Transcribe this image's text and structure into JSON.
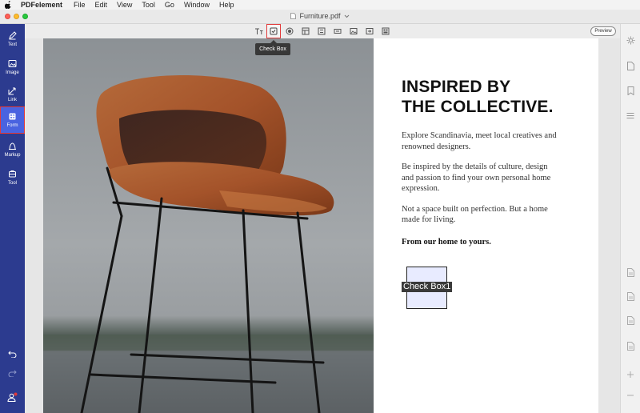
{
  "menubar": {
    "app_name": "PDFelement",
    "items": [
      "File",
      "Edit",
      "View",
      "Tool",
      "Go",
      "Window",
      "Help"
    ]
  },
  "window": {
    "title": "Furniture.pdf"
  },
  "sidebar": {
    "tools": [
      {
        "label": "Text",
        "icon": "text-edit-icon"
      },
      {
        "label": "Image",
        "icon": "image-icon"
      },
      {
        "label": "Link",
        "icon": "link-icon"
      },
      {
        "label": "Form",
        "icon": "form-icon",
        "active": true
      },
      {
        "label": "Markup",
        "icon": "markup-icon"
      },
      {
        "label": "Tool",
        "icon": "tool-icon"
      }
    ]
  },
  "toolbar": {
    "selected_tool": "check-box",
    "tooltip": "Check Box",
    "preview_label": "Preview"
  },
  "document": {
    "headline_line1": "INSPIRED BY",
    "headline_line2": "THE COLLECTIVE.",
    "para1": "Explore Scandinavia, meet local creatives and renowned designers.",
    "para2": "Be inspired by the details of culture, design and passion to find your own personal home expression.",
    "para3": "Not a space built on perfection. But a home made for living.",
    "para4": "From our home to yours.",
    "checkbox_field_name": "Check Box1"
  },
  "colors": {
    "sidebar_bg": "#2c3b8f",
    "active_tool_bg": "#4a63e0",
    "highlight_border": "#e23a3a",
    "chair_leather": "#a4532a"
  }
}
